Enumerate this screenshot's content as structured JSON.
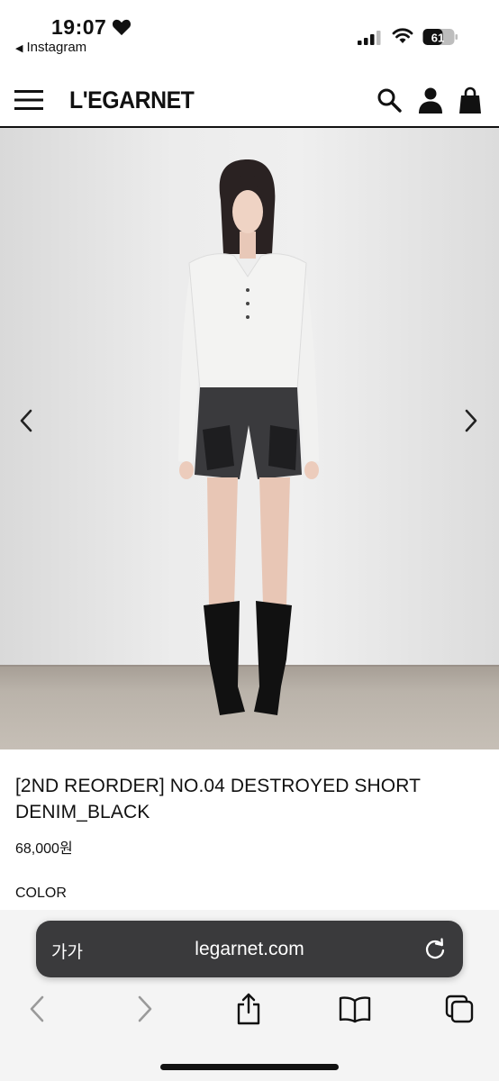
{
  "status_bar": {
    "time": "19:07",
    "back_app": "Instagram",
    "battery": "61"
  },
  "nav": {
    "logo": "L'EGARNET",
    "icons": [
      "menu-icon",
      "search-icon",
      "user-icon",
      "bag-icon"
    ]
  },
  "hero": {
    "icons": [
      "chevron-left-icon",
      "chevron-right-icon"
    ]
  },
  "product": {
    "title": "[2ND REORDER] NO.04 DESTROYED SHORT DENIM_BLACK",
    "price": "68,000원",
    "color_label": "COLOR"
  },
  "browser": {
    "text_size": "가가",
    "url": "legarnet.com",
    "icons": [
      "reload-icon",
      "back-icon",
      "forward-icon",
      "share-icon",
      "bookmarks-icon",
      "tabs-icon"
    ]
  },
  "colors": {
    "url_bar": "#3a3a3c",
    "toolbar": "#f4f4f4",
    "text": "#111111"
  }
}
